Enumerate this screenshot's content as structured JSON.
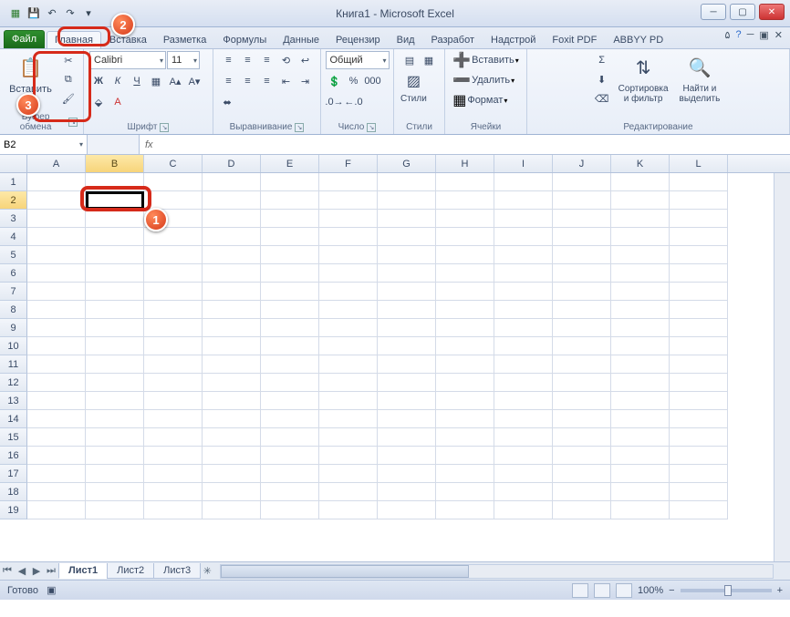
{
  "title": "Книга1  -  Microsoft Excel",
  "qat": {
    "save": "💾",
    "undo": "↶",
    "redo": "↷"
  },
  "tabs": {
    "file": "Файл",
    "items": [
      "Главная",
      "Вставка",
      "Разметка",
      "Формулы",
      "Данные",
      "Рецензир",
      "Вид",
      "Разработ",
      "Надстрой",
      "Foxit PDF",
      "ABBYY PD"
    ],
    "active_index": 0
  },
  "ribbon": {
    "clipboard": {
      "paste": "Вставить",
      "label": "Буфер обмена"
    },
    "font": {
      "name": "Calibri",
      "size": "11",
      "label": "Шрифт"
    },
    "align": {
      "label": "Выравнивание"
    },
    "number": {
      "format": "Общий",
      "label": "Число"
    },
    "styles": {
      "label": "Стили",
      "stylesBtn": "Стили"
    },
    "cells": {
      "insert": "Вставить",
      "delete": "Удалить",
      "format": "Формат",
      "label": "Ячейки"
    },
    "editing": {
      "sort": "Сортировка\nи фильтр",
      "find": "Найти и\nвыделить",
      "label": "Редактирование"
    }
  },
  "formula": {
    "cellref": "B2",
    "fx": "fx",
    "value": ""
  },
  "columns": [
    "A",
    "B",
    "C",
    "D",
    "E",
    "F",
    "G",
    "H",
    "I",
    "J",
    "K",
    "L"
  ],
  "rows": [
    "1",
    "2",
    "3",
    "4",
    "5",
    "6",
    "7",
    "8",
    "9",
    "10",
    "11",
    "12",
    "13",
    "14",
    "15",
    "16",
    "17",
    "18",
    "19"
  ],
  "selected": {
    "col": "B",
    "row": "2"
  },
  "sheets": {
    "items": [
      "Лист1",
      "Лист2",
      "Лист3"
    ],
    "active_index": 0
  },
  "status": {
    "ready": "Готово",
    "zoom": "100%",
    "minus": "−",
    "plus": "+"
  },
  "callouts": {
    "c1": "1",
    "c2": "2",
    "c3": "3"
  }
}
